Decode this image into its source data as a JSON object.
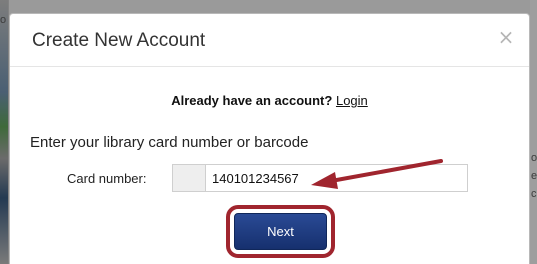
{
  "modal": {
    "title": "Create New Account",
    "close_symbol": "×"
  },
  "account_prompt": {
    "text": "Already have an account?",
    "login_label": "Login"
  },
  "form": {
    "instruction": "Enter your library card number or barcode",
    "card_label": "Card number:",
    "card_value": "140101234567"
  },
  "actions": {
    "next_label": "Next"
  },
  "annotations": {
    "arrow_color": "#a0252e",
    "highlight_color": "#a0252e"
  },
  "background": {
    "left_chars": [
      "o"
    ],
    "right_chars": [
      "o",
      "es",
      "cc"
    ]
  },
  "icons": {
    "close": "close-icon",
    "arrow": "red-arrow-annotation-icon"
  }
}
